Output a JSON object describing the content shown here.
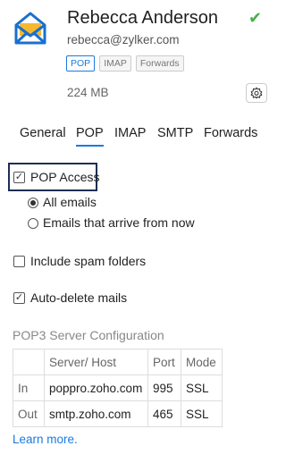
{
  "account": {
    "name": "Rebecca Anderson",
    "email": "rebecca@zylker.com",
    "badges": [
      "POP",
      "IMAP",
      "Forwards"
    ],
    "size": "224 MB"
  },
  "tabs": [
    "General",
    "POP",
    "IMAP",
    "SMTP",
    "Forwards"
  ],
  "pop": {
    "access_label": "POP Access",
    "access_checked": true,
    "radio_all": "All emails",
    "radio_new": "Emails that arrive from now",
    "spam_label": "Include spam folders",
    "spam_checked": false,
    "autodelete_label": "Auto-delete mails",
    "autodelete_checked": true
  },
  "server": {
    "title": "POP3 Server Configuration",
    "headers": [
      "",
      "Server/ Host",
      "Port",
      "Mode"
    ],
    "rows": [
      [
        "In",
        "poppro.zoho.com",
        "995",
        "SSL"
      ],
      [
        "Out",
        "smtp.zoho.com",
        "465",
        "SSL"
      ]
    ]
  },
  "learn_more": "Learn more.",
  "icons": {
    "logo": "mail-envelope-icon",
    "verified": "checkmark-icon",
    "settings": "gear-icon"
  },
  "colors": {
    "accent": "#1a7ae0",
    "verified": "#48b04a",
    "focus_border": "#1c2f52"
  }
}
